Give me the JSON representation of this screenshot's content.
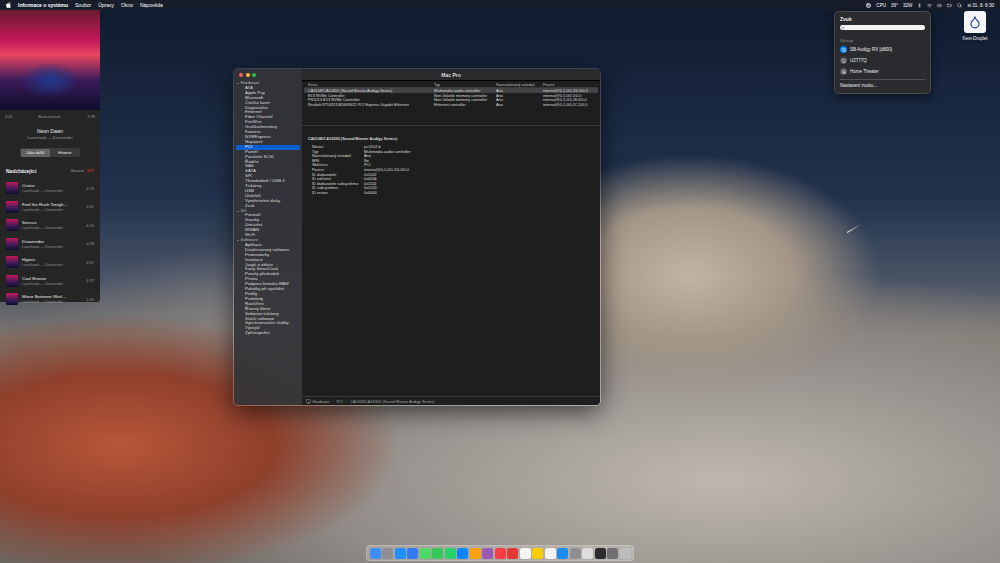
{
  "menu_bar": {
    "app": "Informace o systému",
    "items": [
      "Soubor",
      "Úpravy",
      "Okno",
      "Nápověda"
    ],
    "status": [
      "CPU",
      "39°",
      "32W"
    ],
    "clock": "st 31. 8. 6:30"
  },
  "player": {
    "progress": {
      "level": 0.54,
      "elapsed": "3:02",
      "remaining": "-2:38"
    },
    "quality": "Bezeztrátové",
    "track": "Neon Dawn",
    "artist": "Lazerhawk — Dreamrider",
    "tabs": [
      {
        "label": "Jako další",
        "selected": true
      },
      {
        "label": "Historie",
        "selected": false
      }
    ],
    "queue_title": "Nadcházející",
    "clear": "Smazat",
    "autoplay_on": true,
    "queue": [
      {
        "title": "Cruise",
        "artist": "Lazerhawk — Dreamrider",
        "duration": "4:23"
      },
      {
        "title": "Feel the Rush Tonigh…",
        "artist": "Lazerhawk — Dreamrider",
        "duration": "3:31"
      },
      {
        "title": "Sensus",
        "artist": "Lazerhawk — Dreamrider",
        "duration": "4:16"
      },
      {
        "title": "Dreamrider",
        "artist": "Lazerhawk — Dreamrider",
        "duration": "4:58"
      },
      {
        "title": "Hypnic",
        "artist": "Lazerhawk — Dreamrider",
        "duration": "4:07"
      },
      {
        "title": "Cool Breeze",
        "artist": "Lazerhawk — Dreamrider",
        "duration": "4:37"
      },
      {
        "title": "Mirror Between Worl…",
        "artist": "Lazerhawk — Dreamrider",
        "duration": "2:33"
      }
    ]
  },
  "window": {
    "title": "Mac Pro",
    "sidebar": [
      {
        "label": "Hardware",
        "expanded": true,
        "items": [
          {
            "label": "ATA",
            "selected": false
          },
          {
            "label": "Apple Pay",
            "selected": false
          },
          {
            "label": "Bluetooth",
            "selected": false
          },
          {
            "label": "Čtečka karet",
            "selected": false
          },
          {
            "label": "Diagnostika",
            "selected": false
          },
          {
            "label": "Ethernet",
            "selected": false
          },
          {
            "label": "Fibre Channel",
            "selected": false
          },
          {
            "label": "FireWire",
            "selected": false
          },
          {
            "label": "Grafika/monitory",
            "selected": false
          },
          {
            "label": "Kamera",
            "selected": false
          },
          {
            "label": "NVMExpress",
            "selected": false
          },
          {
            "label": "Napájení",
            "selected": false
          },
          {
            "label": "PCI",
            "selected": true
          },
          {
            "label": "Paměť",
            "selected": false
          },
          {
            "label": "Paralelní SCSI",
            "selected": false
          },
          {
            "label": "Řadiče",
            "selected": false
          },
          {
            "label": "SAS",
            "selected": false
          },
          {
            "label": "SATA",
            "selected": false
          },
          {
            "label": "SPI",
            "selected": false
          },
          {
            "label": "Thunderbolt / USB 4",
            "selected": false
          },
          {
            "label": "Tiskárny",
            "selected": false
          },
          {
            "label": "USB",
            "selected": false
          },
          {
            "label": "Úložiště",
            "selected": false
          },
          {
            "label": "Vyměnitelné disky",
            "selected": false
          },
          {
            "label": "Zvuk",
            "selected": false
          }
        ]
      },
      {
        "label": "Síť",
        "expanded": true,
        "items": [
          {
            "label": "Firewall",
            "selected": false
          },
          {
            "label": "Svazky",
            "selected": false
          },
          {
            "label": "Umístění",
            "selected": false
          },
          {
            "label": "WWAN",
            "selected": false
          },
          {
            "label": "Wi-Fi",
            "selected": false
          }
        ]
      },
      {
        "label": "Software",
        "expanded": true,
        "items": [
          {
            "label": "Aplikace",
            "selected": false
          },
          {
            "label": "Deaktivovaný software",
            "selected": false
          },
          {
            "label": "Frameworky",
            "selected": false
          },
          {
            "label": "Instalace",
            "selected": false
          },
          {
            "label": "Jazyk a oblast",
            "selected": false
          },
          {
            "label": "Karty SmartCard",
            "selected": false
          },
          {
            "label": "Panely předvoleb",
            "selected": false
          },
          {
            "label": "Písma",
            "selected": false
          },
          {
            "label": "Podpora formátu RAW",
            "selected": false
          },
          {
            "label": "Položky při spuštění",
            "selected": false
          },
          {
            "label": "Profily",
            "selected": false
          },
          {
            "label": "Protokoly",
            "selected": false
          },
          {
            "label": "Rozšíření",
            "selected": false
          },
          {
            "label": "Řízený klient",
            "selected": false
          },
          {
            "label": "Software tiskárny",
            "selected": false
          },
          {
            "label": "Starší software",
            "selected": false
          },
          {
            "label": "Synchronizační služby",
            "selected": false
          },
          {
            "label": "Vývojář",
            "selected": false
          },
          {
            "label": "Zpřístupnění",
            "selected": false
          }
        ]
      }
    ],
    "table": {
      "columns": [
        "Karta",
        "Typ",
        "Nainstalovaný ovladač",
        "Pozice"
      ],
      "rows": [
        {
          "cells": [
            "CA0108/CA10300 (Sound Blaster Audigy Series)",
            "Multimedia audio controller",
            "Ano",
            "internal@0,1,0/0,2/0,0/0,0"
          ],
          "selected": true
        },
        {
          "cells": [
            "E13 NVMe Controller",
            "Non-Volatile memory controller",
            "Ano",
            "internal@0,1,0/0,1/0,0"
          ],
          "selected": false
        },
        {
          "cells": [
            "PS5013-E13 NVMe Controller",
            "Non-Volatile memory controller",
            "Ano",
            "internal@0,1,0/0,28,0/0,0"
          ],
          "selected": false
        },
        {
          "cells": [
            "Realtek RTL8111/8168/8411 PCI Express Gigabit Ethernet",
            "Ethernet controller",
            "Ano",
            "internal@0,1,0/0,1C,5/0,0"
          ],
          "selected": false
        }
      ]
    },
    "detail": {
      "title": "CA0108/CA10300 (Sound Blaster Audigy Series):",
      "fields": [
        {
          "label": "Název:",
          "value": "pci1102,b"
        },
        {
          "label": "Typ:",
          "value": "Multimedia audio controller"
        },
        {
          "label": "Nainstalovaný ovladač:",
          "value": "Ano"
        },
        {
          "label": "MSI:",
          "value": "Ne"
        },
        {
          "label": "Sběrnice:",
          "value": "PCI"
        },
        {
          "label": "Pozice:",
          "value": "internal@0,1,0/0,2/0,0/0,0"
        },
        {
          "label": "ID dodavatele:",
          "value": "0x1102"
        },
        {
          "label": "ID zařízení:",
          "value": "0x000b"
        },
        {
          "label": "ID dodavatele subsystému:",
          "value": "0x1102"
        },
        {
          "label": "ID subsystému:",
          "value": "0x1024"
        },
        {
          "label": "ID revize:",
          "value": "0x0000"
        }
      ]
    },
    "path": [
      "Hardware",
      "PCI",
      "CA0108/CA10300 (Sound Blaster Audigy Series)"
    ]
  },
  "sound_menu": {
    "title": "Zvuk",
    "volume": {
      "level": 1
    },
    "output_label": "Výstup",
    "devices": [
      {
        "name": "SB Audigy RX [d800]",
        "kind": "speaker",
        "selected": true
      },
      {
        "name": "U2777Q",
        "kind": "display",
        "selected": false
      },
      {
        "name": "Home Theater",
        "kind": "speaker",
        "selected": false
      }
    ],
    "settings": "Nastavení zvuku…"
  },
  "desktop_icons": [
    {
      "label": "Kext-Droplet"
    }
  ],
  "dock": [
    {
      "color": "#3f8ef7"
    },
    {
      "color": "#8e8e93"
    },
    {
      "color": "#1e90ff"
    },
    {
      "color": "#2f7cf6"
    },
    {
      "color": "#4cd964"
    },
    {
      "color": "#34c759"
    },
    {
      "color": "#25d366"
    },
    {
      "color": "#0a84ff"
    },
    {
      "color": "#ff9f0a"
    },
    {
      "color": "#9b59b6"
    },
    {
      "color": "#fc3c44"
    },
    {
      "color": "#e53935"
    },
    {
      "color": "#f5f5f5"
    },
    {
      "color": "#ffcc00"
    },
    {
      "color": "#f2f2f2"
    },
    {
      "color": "#1c8cf0"
    },
    {
      "color": "#8e8e93"
    },
    {
      "color": "#dcdcdc"
    },
    {
      "color": "#2c2c2e"
    },
    {
      "color": "#6e6e73"
    },
    {
      "color": "#bdbdbd"
    }
  ]
}
